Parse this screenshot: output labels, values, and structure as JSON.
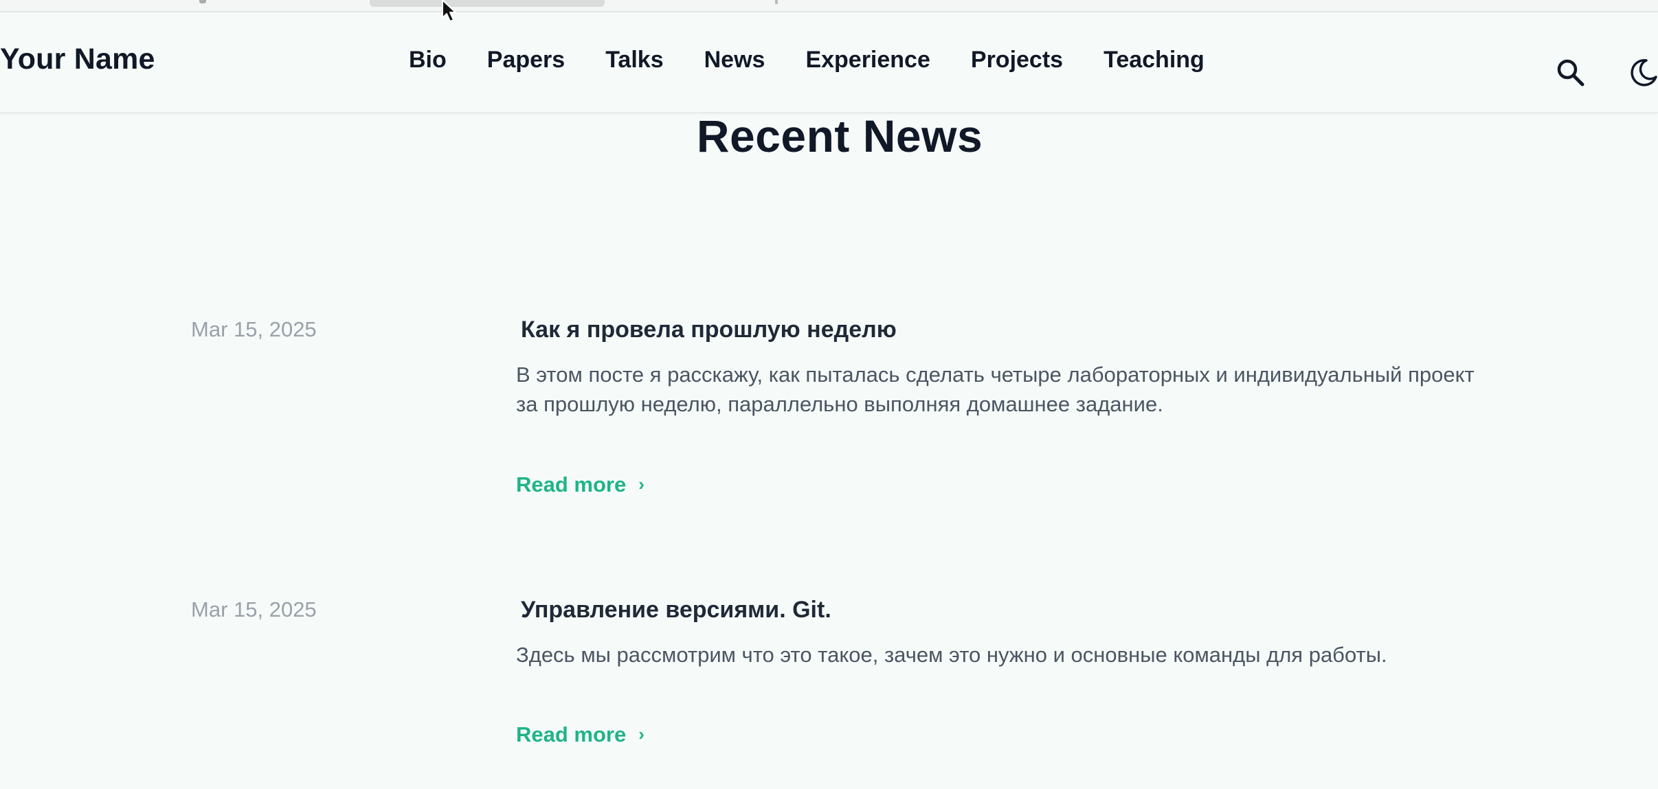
{
  "site": {
    "brand": "Your Name"
  },
  "nav": {
    "items": [
      "Bio",
      "Papers",
      "Talks",
      "News",
      "Experience",
      "Projects",
      "Teaching"
    ]
  },
  "icons": {
    "search": "search-icon",
    "theme": "moon-icon"
  },
  "page": {
    "title": "Recent News"
  },
  "posts": [
    {
      "date": "Mar 15, 2025",
      "title": "Как я провела прошлую неделю",
      "summary": "В этом посте я расскажу, как пыталась сделать четыре лабораторных и индивидуальный проект за прошлую неделю, параллельно выполняя домашнее задание.",
      "read_more": "Read more"
    },
    {
      "date": "Mar 15, 2025",
      "title": "Управление версиями. Git.",
      "summary": "Здесь мы рассмотрим что это такое, зачем это нужно и основные команды для работы.",
      "read_more": "Read more"
    }
  ],
  "colors": {
    "background": "#f6fbf9",
    "accent": "#1fb486",
    "text": "#111827",
    "muted": "#9aa0a8"
  }
}
